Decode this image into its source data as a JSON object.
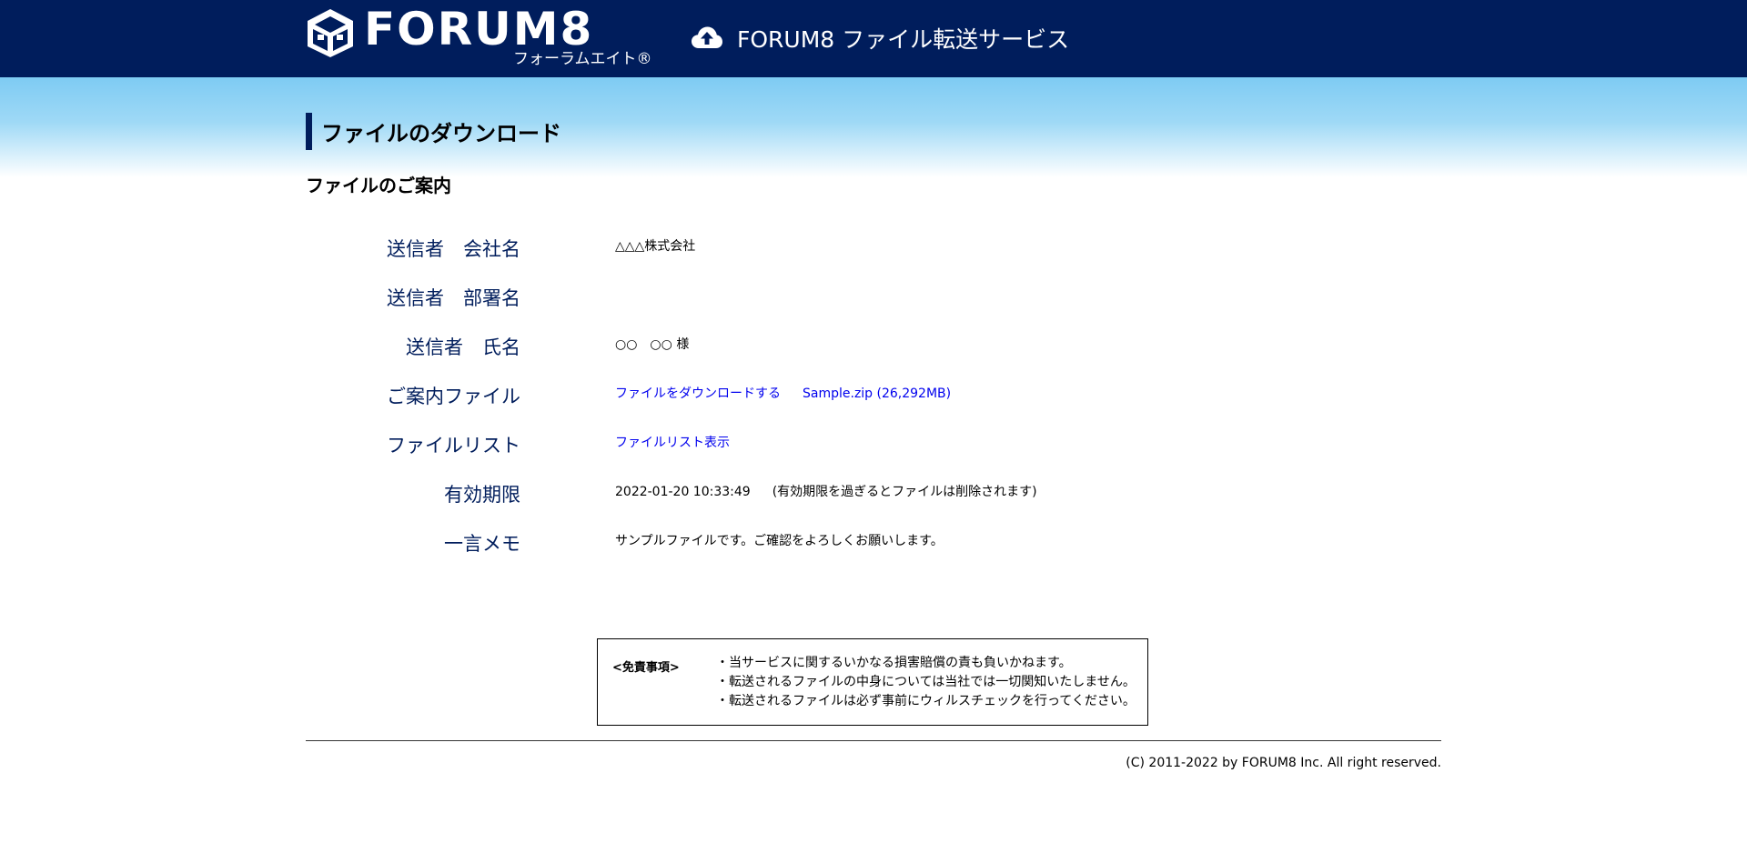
{
  "header": {
    "logo_text": "FORUM8",
    "logo_kana": "フォーラムエイト®",
    "service_title": "FORUM8 ファイル転送サービス",
    "icon": "cloud-upload-icon",
    "background_color": "#001d5c"
  },
  "page": {
    "heading": "ファイルのダウンロード",
    "section_title": "ファイルのご案内"
  },
  "info": {
    "company_label": "送信者　会社名",
    "company_value": "△△△株式会社",
    "department_label": "送信者　部署名",
    "department_value": "",
    "name_label": "送信者　氏名",
    "name_value": "○○　○○ 様",
    "file_label": "ご案内ファイル",
    "download_link": "ファイルをダウンロードする",
    "file_name": "Sample.zip (26,292MB)",
    "filelist_label": "ファイルリスト",
    "filelist_link": "ファイルリスト表示",
    "expiry_label": "有効期限",
    "expiry_value": "2022-01-20 10:33:49",
    "expiry_note": "(有効期限を過ぎるとファイルは削除されます)",
    "memo_label": "一言メモ",
    "memo_value": "サンプルファイルです。ご確認をよろしくお願いします。"
  },
  "disclaimer": {
    "title": "<免責事項>",
    "items": [
      "・当サービスに関するいかなる損害賠償の責も負いかねます。",
      "・転送されるファイルの中身については当社では一切関知いたしません。",
      "・転送されるファイルは必ず事前にウィルスチェックを行ってください。"
    ]
  },
  "footer": {
    "copyright": "(C) 2011-2022 by FORUM8 Inc. All right reserved."
  },
  "colors": {
    "label": "#001d5c",
    "link": "#0000ee",
    "gradient_top": "#7ecbf3"
  }
}
